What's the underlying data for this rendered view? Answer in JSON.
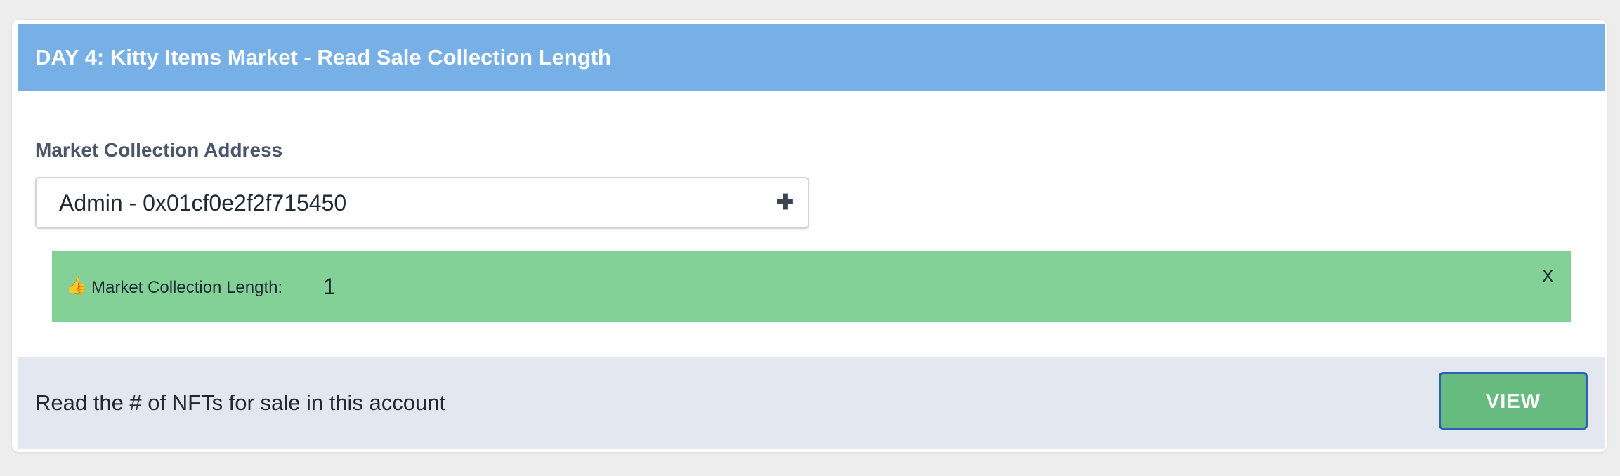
{
  "header": {
    "title": "DAY 4: Kitty Items Market - Read Sale Collection Length"
  },
  "form": {
    "field_label": "Market Collection Address",
    "select_value": "Admin - 0x01cf0e2f2f715450",
    "select_icon": "plus-icon"
  },
  "alert": {
    "icon": "thumbs-up-icon",
    "label": "Market Collection Length:",
    "value": "1",
    "close_label": "X"
  },
  "footer": {
    "description": "Read the # of NFTs for sale in this account",
    "button_label": "VIEW"
  },
  "colors": {
    "header_bg": "#77b0e6",
    "alert_bg": "#84d197",
    "footer_bg": "#e3e7f0",
    "button_bg": "#68bb7f",
    "button_border": "#2b5fba"
  }
}
